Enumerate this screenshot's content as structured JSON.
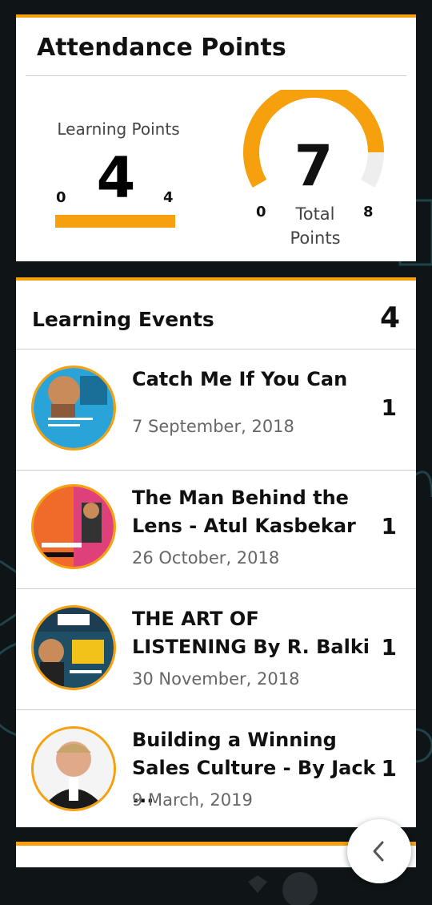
{
  "attendance": {
    "title": "Attendance Points",
    "learning_points": {
      "label": "Learning Points",
      "value": "4",
      "min": "0",
      "max": "4",
      "progress": 1.0
    },
    "total_points": {
      "value": "7",
      "label": "Total Points",
      "min": "0",
      "max": "8",
      "progress": 0.875
    }
  },
  "learning_events": {
    "title": "Learning Events",
    "count": "4",
    "items": [
      {
        "name": "Catch Me If You Can",
        "date": "7 September, 2018",
        "points": "1",
        "thumb_icon": "event-poster-catch-me"
      },
      {
        "name": "The Man Behind the Lens - Atul Kasbekar",
        "date": "26 October, 2018",
        "points": "1",
        "thumb_icon": "event-poster-atul-kasbekar"
      },
      {
        "name": "THE ART OF LISTENING By R. Balki",
        "date": "30 November, 2018",
        "points": "1",
        "thumb_icon": "event-poster-art-of-listening"
      },
      {
        "name": "Building a Winning Sales Culture - By Jack ...",
        "date": "9 March, 2019",
        "points": "1",
        "thumb_icon": "speaker-photo-jack"
      }
    ]
  },
  "colors": {
    "accent": "#f5a00c",
    "background": "#0f1417"
  },
  "icons": {
    "back": "chevron-left-icon"
  }
}
